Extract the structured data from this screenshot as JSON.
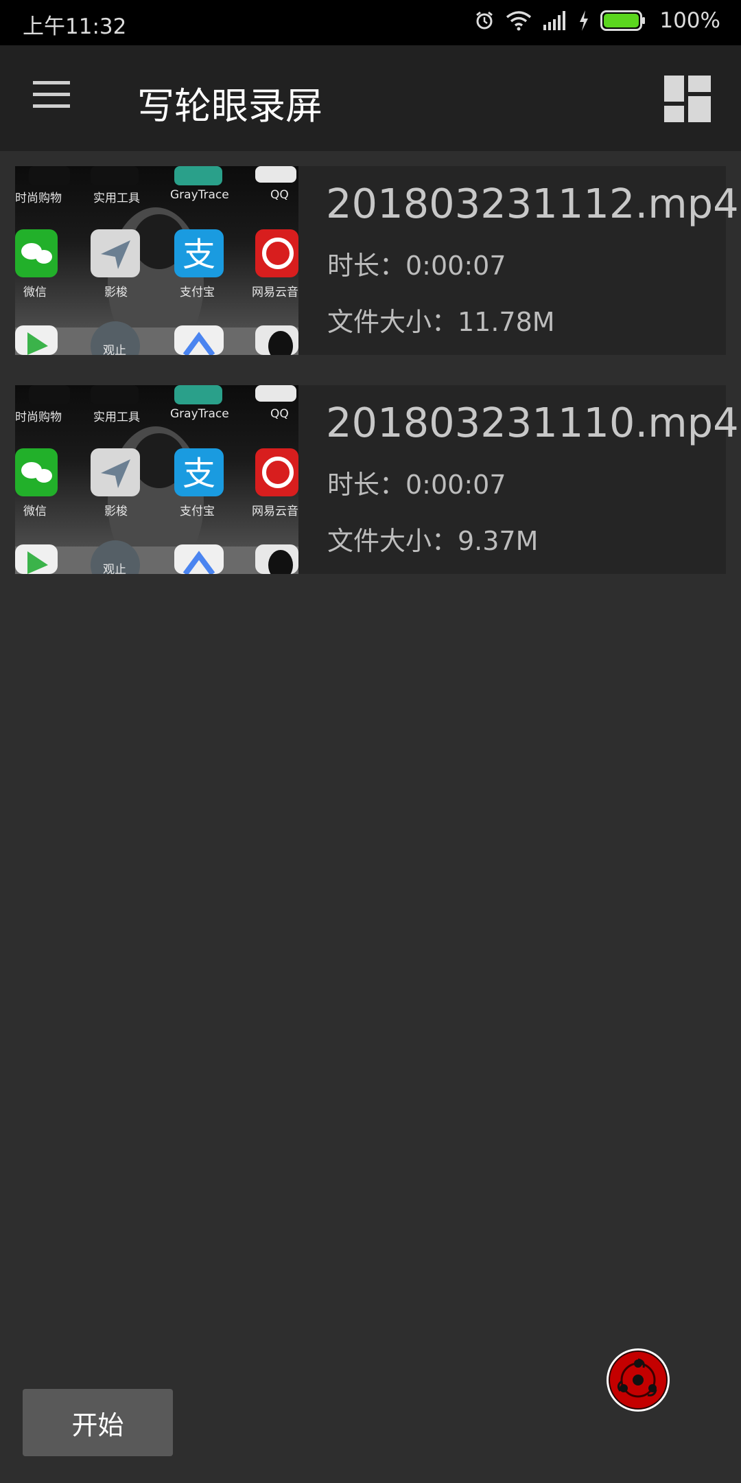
{
  "status_bar": {
    "time": "上午11:32",
    "battery_percent": "100%",
    "icons": [
      "alarm-icon",
      "wifi-icon",
      "signal-icon",
      "charging-icon",
      "battery-icon"
    ],
    "battery_color": "#5bd61e"
  },
  "app_bar": {
    "title": "写轮眼录屏",
    "icons": [
      "menu-icon",
      "layout-grid-icon"
    ]
  },
  "thumbnail_apps": {
    "row1": [
      "时尚购物",
      "实用工具",
      "GrayTrace",
      "QQ"
    ],
    "row2": [
      "微信",
      "影梭",
      "支付宝",
      "网易云音乐"
    ],
    "row3": [
      "",
      "观止",
      "",
      ""
    ]
  },
  "videos": [
    {
      "file_name": "201803231112.mp4",
      "duration": "时长：0:00:07",
      "size": "文件大小：11.78M"
    },
    {
      "file_name": "201803231110.mp4",
      "duration": "时长：0:00:07",
      "size": "文件大小：9.37M"
    }
  ],
  "fab": {
    "icon": "sharingan-icon",
    "color": "#c40000"
  },
  "start_button": {
    "label": "开始"
  }
}
